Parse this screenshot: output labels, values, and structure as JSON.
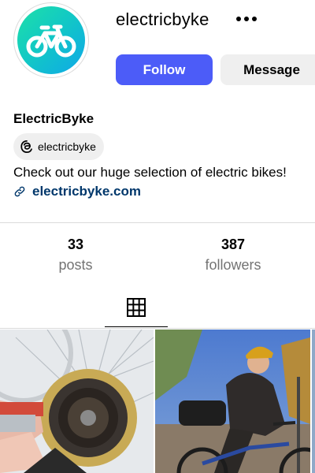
{
  "profile": {
    "username": "electricbyke",
    "display_name": "ElectricByke",
    "threads_handle": "electricbyke",
    "bio": "Check out our huge selection of electric bikes!",
    "link": "electricbyke.com"
  },
  "actions": {
    "follow_label": "Follow",
    "message_label": "Message"
  },
  "stats": {
    "posts_count": "33",
    "posts_label": "posts",
    "followers_count": "387",
    "followers_label": "followers"
  },
  "icons": {
    "avatar": "bicycle-logo-icon",
    "more": "more-options-icon",
    "threads": "threads-icon",
    "link": "link-icon",
    "grid_tab": "grid-icon"
  },
  "colors": {
    "follow_button": "#4c5cf8",
    "link_text": "#00376b",
    "secondary_text": "#737373"
  },
  "posts": [
    {
      "subject": "bicycle-cassette-lubrication-photo"
    },
    {
      "subject": "man-riding-bicycle-photo"
    },
    {
      "subject": "partial-photo"
    }
  ]
}
